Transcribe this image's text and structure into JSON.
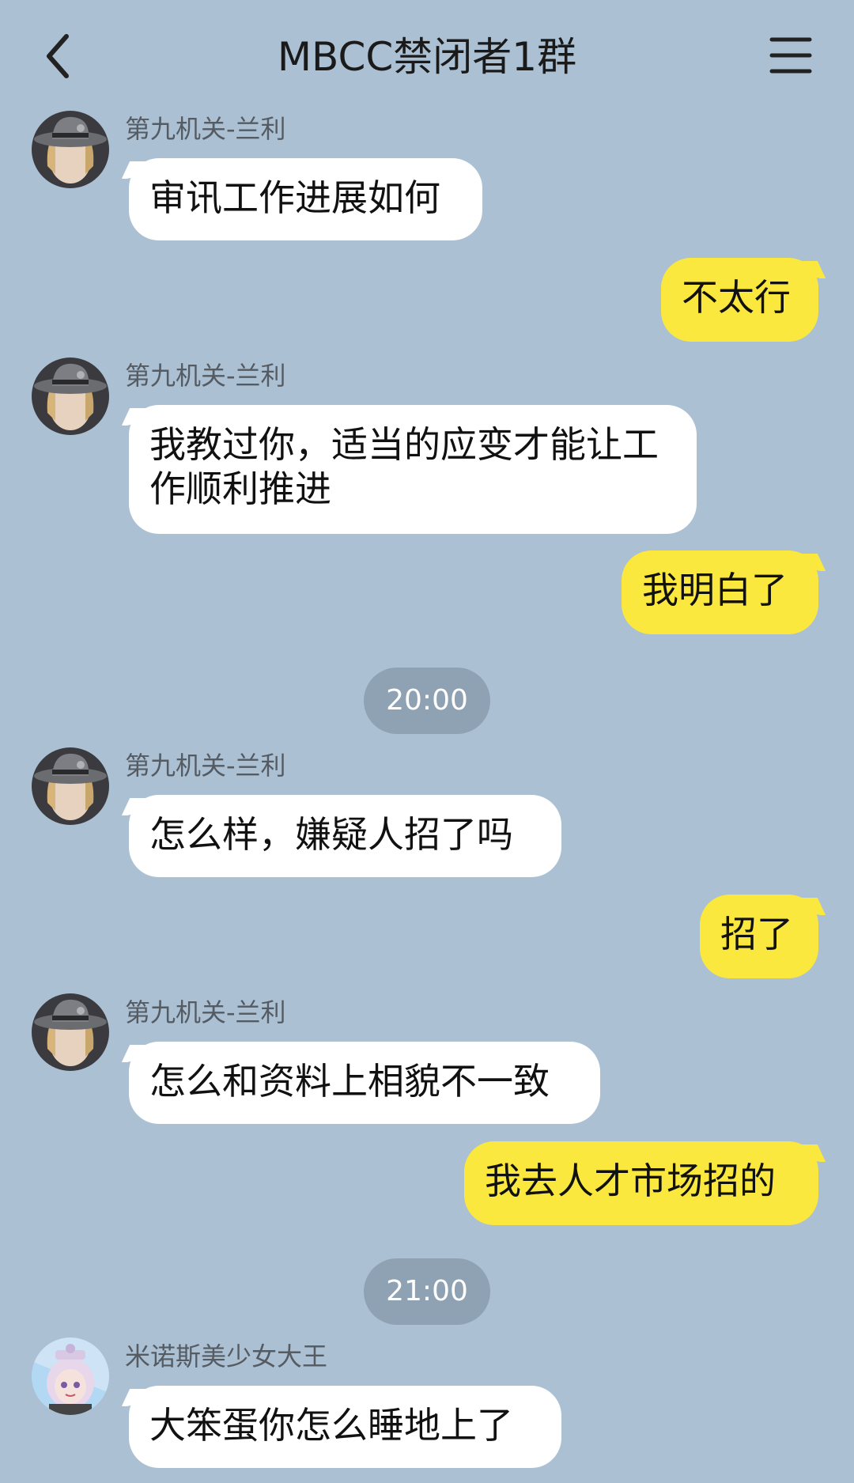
{
  "header": {
    "title": "MBCC禁闭者1群",
    "back_icon": "chevron-left-icon",
    "menu_icon": "hamburger-menu-icon"
  },
  "messages": [
    {
      "direction": "in",
      "sender": "第九机关-兰利",
      "text": "审讯工作进展如何"
    },
    {
      "direction": "out",
      "text": "不太行"
    },
    {
      "direction": "in",
      "sender": "第九机关-兰利",
      "text": "我教过你，适当的应变才能让工作顺利推进"
    },
    {
      "direction": "out",
      "text": "我明白了"
    },
    {
      "type": "time",
      "text": "20:00"
    },
    {
      "direction": "in",
      "sender": "第九机关-兰利",
      "text": "怎么样，嫌疑人招了吗"
    },
    {
      "direction": "out",
      "text": "招了"
    },
    {
      "direction": "in",
      "sender": "第九机关-兰利",
      "text": "怎么和资料上相貌不一致"
    },
    {
      "direction": "out",
      "text": "我去人才市场招的"
    },
    {
      "type": "time",
      "text": "21:00"
    },
    {
      "direction": "in",
      "sender": "米诺斯美少女大王",
      "text": "大笨蛋你怎么睡地上了"
    }
  ],
  "colors": {
    "background": "#abc0d3",
    "incoming_bubble": "#ffffff",
    "outgoing_bubble": "#fbe83e",
    "time_pill": "#8fa2b4"
  }
}
